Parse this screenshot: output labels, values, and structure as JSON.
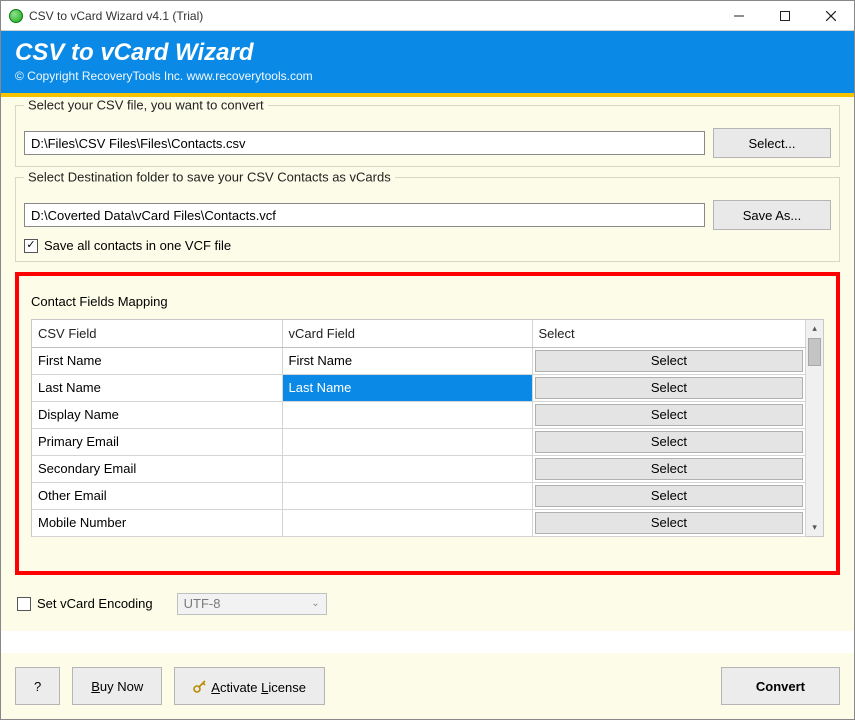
{
  "window": {
    "title": "CSV to vCard Wizard v4.1 (Trial)"
  },
  "header": {
    "title": "CSV to vCard Wizard",
    "subtitle": "© Copyright RecoveryTools Inc. www.recoverytools.com"
  },
  "source": {
    "legend": "Select your CSV file, you want to convert",
    "path_value": "D:\\Files\\CSV Files\\Files\\Contacts.csv",
    "select_label": "Select..."
  },
  "destination": {
    "legend": "Select Destination folder to save your CSV Contacts as vCards",
    "path_value": "D:\\Coverted Data\\vCard Files\\Contacts.vcf",
    "save_label": "Save As...",
    "save_all_label": "Save all contacts in one VCF file",
    "save_all_checked": true
  },
  "mapping": {
    "legend": "Contact Fields Mapping",
    "columns": {
      "csv": "CSV Field",
      "vcard": "vCard Field",
      "select": "Select"
    },
    "select_button_label": "Select",
    "rows": [
      {
        "csv": "First Name",
        "vcard": "First Name",
        "selected": false
      },
      {
        "csv": "Last Name",
        "vcard": "Last Name",
        "selected": true
      },
      {
        "csv": "Display Name",
        "vcard": "",
        "selected": false
      },
      {
        "csv": "Primary Email",
        "vcard": "",
        "selected": false
      },
      {
        "csv": "Secondary Email",
        "vcard": "",
        "selected": false
      },
      {
        "csv": "Other Email",
        "vcard": "",
        "selected": false
      },
      {
        "csv": "Mobile Number",
        "vcard": "",
        "selected": false
      }
    ]
  },
  "encoding": {
    "checkbox_label": "Set vCard Encoding",
    "checkbox_checked": false,
    "value": "UTF-8"
  },
  "footer": {
    "help": "?",
    "buy_prefix": "B",
    "buy_rest": "uy Now",
    "activate_prefix": "A",
    "activate_rest": "ctivate ",
    "activate_prefix2": "L",
    "activate_rest2": "icense",
    "convert": "Convert"
  }
}
